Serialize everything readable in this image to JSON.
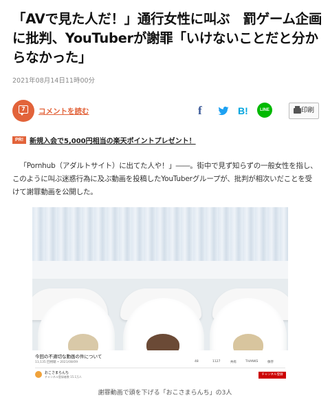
{
  "article": {
    "title": "「AVで見た人だ！」通行女性に叫ぶ　罰ゲーム企画に批判、YouTuberが謝罪「いけないことだと分からなかった」",
    "date": "2021年08月14日11時00分"
  },
  "share": {
    "comment_count": "7",
    "comment_link": "コメントを読む",
    "facebook_icon": "f",
    "hatena_icon": "B!",
    "line_icon": "LINE",
    "print_label": "印刷"
  },
  "promo": {
    "badge": "PR!",
    "text": "新規入会で5,000円相当の楽天ポイントプレゼント！"
  },
  "body": {
    "paragraph": "「Pornhub（アダルトサイト）に出てた人や！」――。街中で見ず知らずの一般女性を指し、このように叫ぶ迷惑行為に及ぶ動画を投稿したYouTuberグループが、批判が相次いだことを受けて謝罪動画を公開した。"
  },
  "video": {
    "title": "今回の不適切な動画の件について",
    "views": "11,135 回視聴 • 2021/08/09",
    "likes": "48",
    "dislikes": "1127",
    "share": "共有",
    "thanks": "THANKS",
    "save": "保存",
    "channel": "おこさまらんち",
    "subscribers": "チャンネル登録者数 15.1万人",
    "subscribe_button": "チャンネル登録"
  },
  "figure": {
    "caption": "謝罪動画で頭を下げる「おこさまらんち」の3人"
  },
  "colors": {
    "accent": "#e2633a",
    "facebook": "#3b5998",
    "twitter": "#1da1f2",
    "hatena": "#00a4de",
    "line": "#00b900"
  }
}
